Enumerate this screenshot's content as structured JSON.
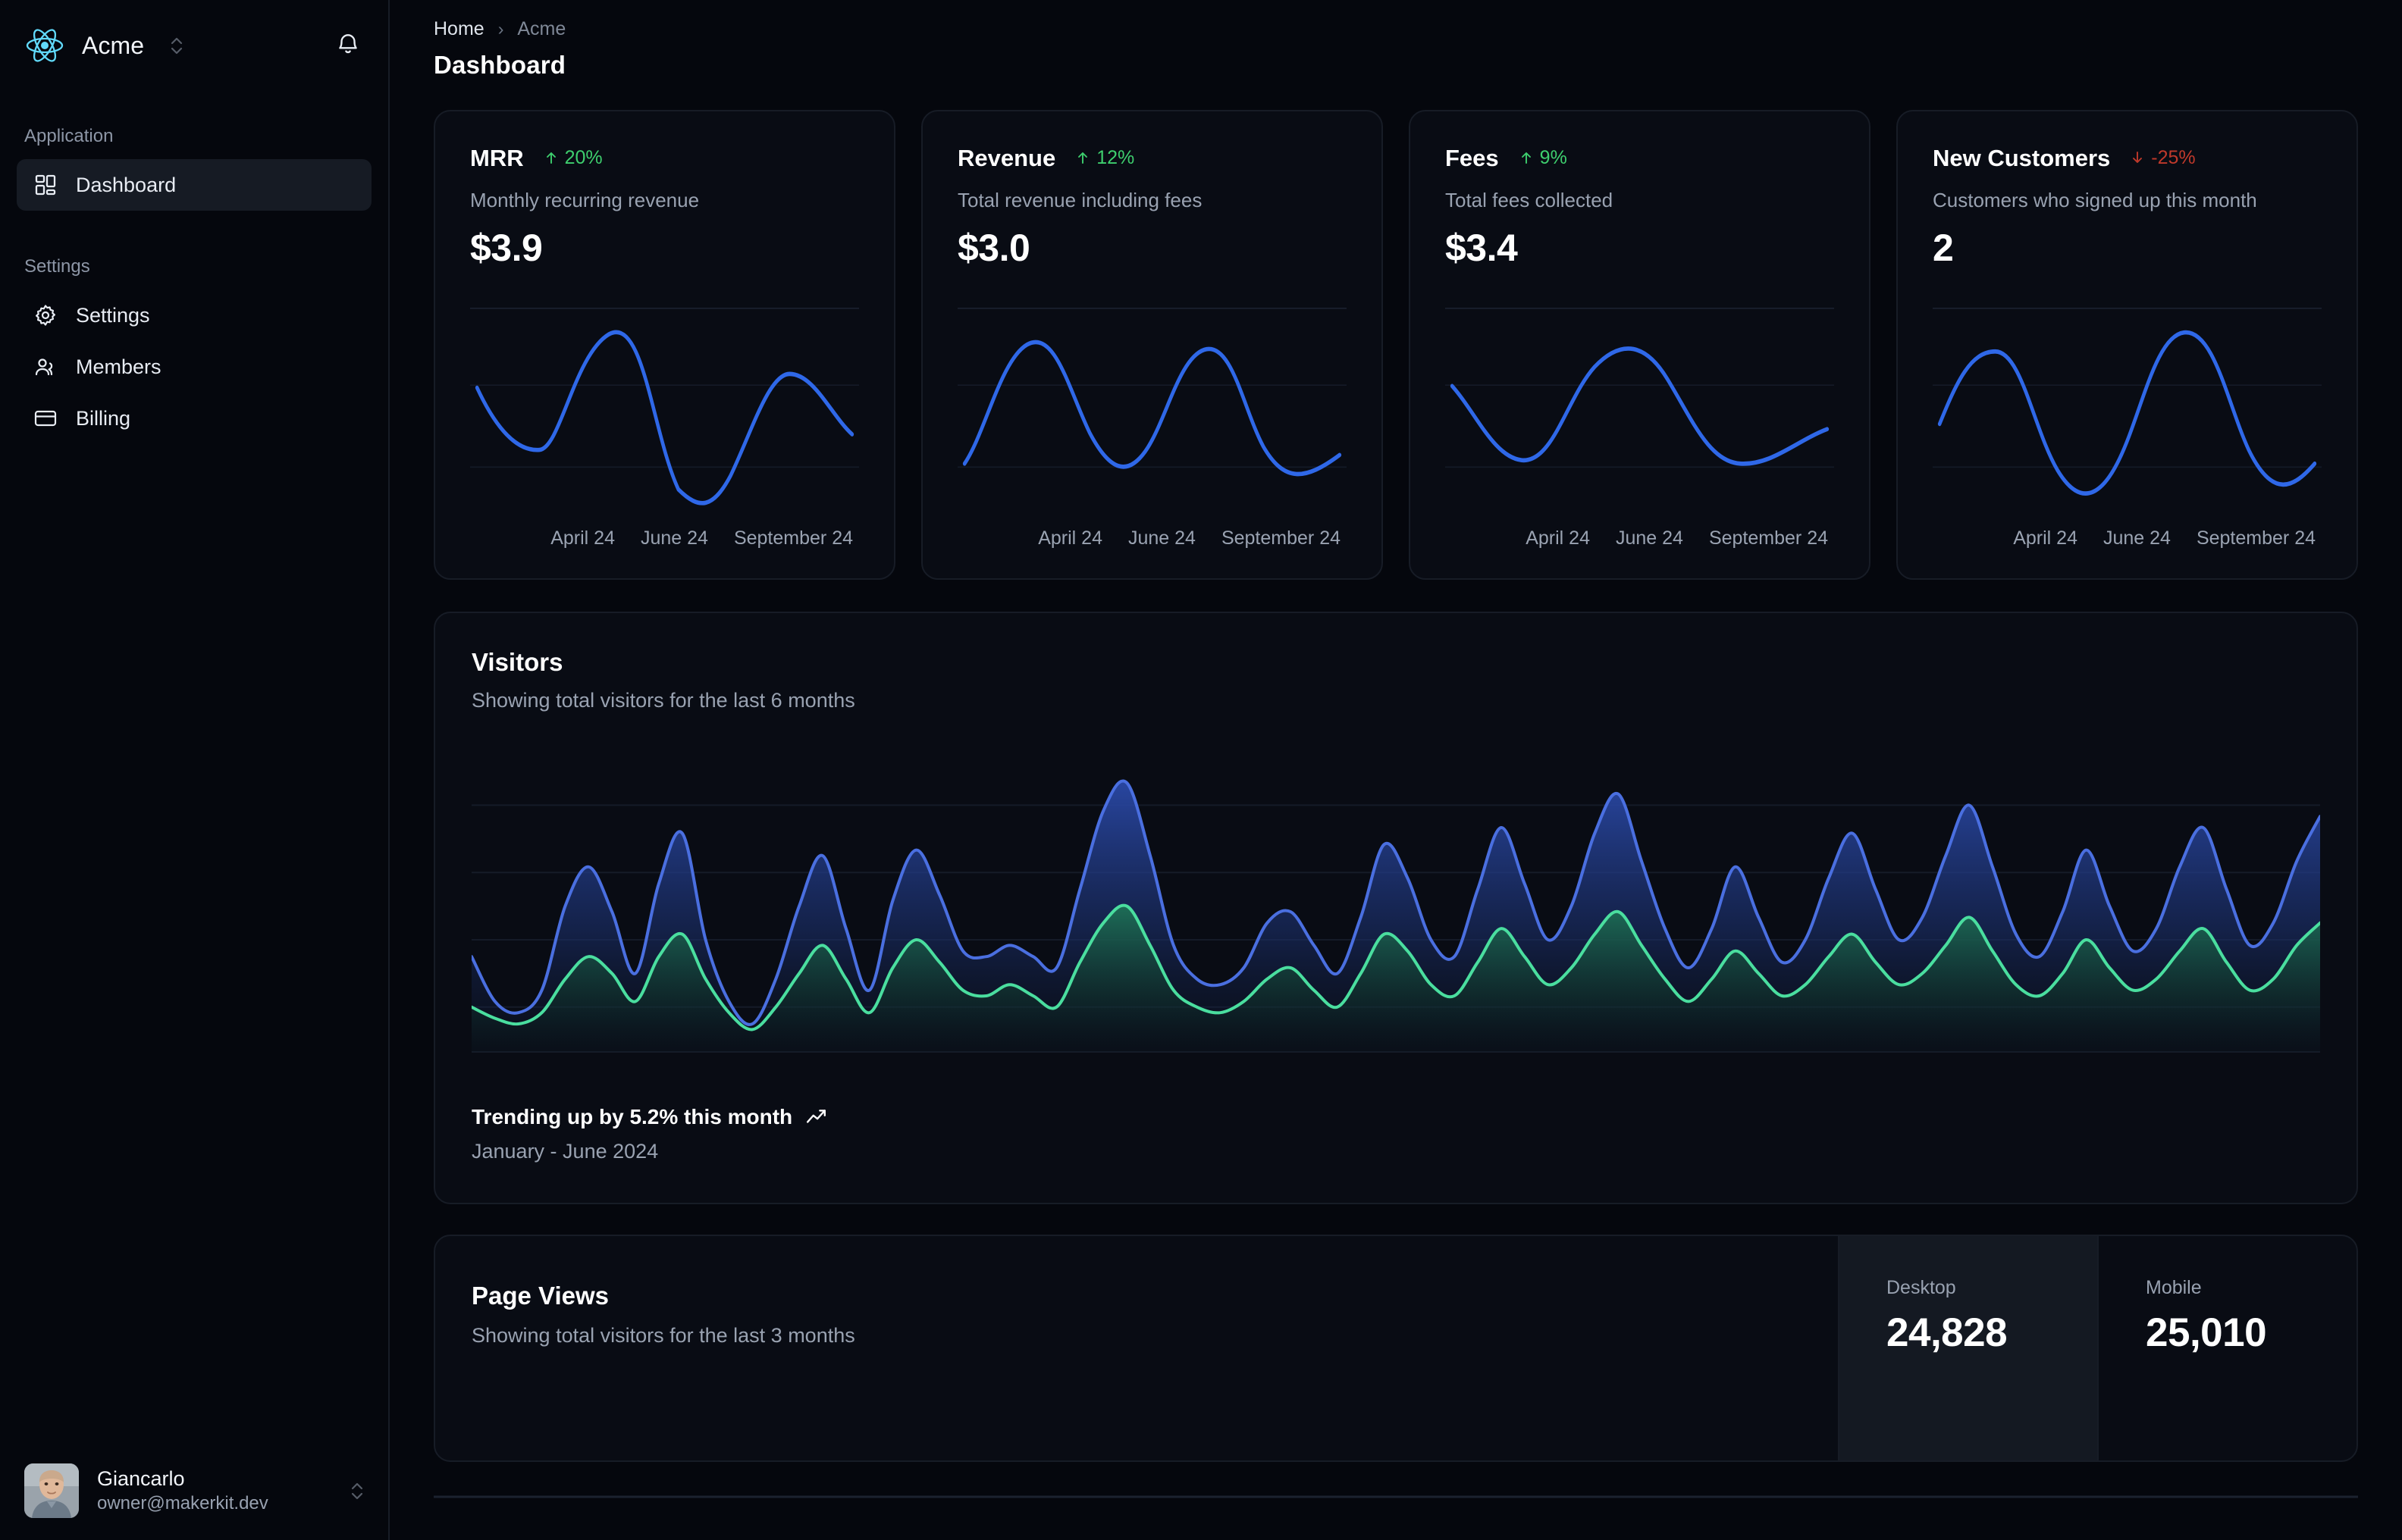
{
  "sidebar": {
    "brand": {
      "name": "Acme",
      "logo_icon": "react-atom-icon",
      "switcher_icon": "chevron-up-down-icon",
      "logo_color": "#61dafb"
    },
    "notifications_icon": "bell-icon",
    "groups": [
      {
        "label": "Application",
        "items": [
          {
            "label": "Dashboard",
            "icon": "layout-dashboard-icon",
            "active": true
          }
        ]
      },
      {
        "label": "Settings",
        "items": [
          {
            "label": "Settings",
            "icon": "gear-icon",
            "active": false
          },
          {
            "label": "Members",
            "icon": "users-icon",
            "active": false
          },
          {
            "label": "Billing",
            "icon": "credit-card-icon",
            "active": false
          }
        ]
      }
    ],
    "user": {
      "name": "Giancarlo",
      "email": "owner@makerkit.dev",
      "avatar_icon": "user-avatar",
      "switcher_icon": "chevron-up-down-icon"
    }
  },
  "header": {
    "breadcrumb": {
      "home": "Home",
      "separator": "›",
      "current": "Acme"
    },
    "title": "Dashboard"
  },
  "stat_cards": [
    {
      "title": "MRR",
      "trend": "20%",
      "trend_dir": "up",
      "trend_icon": "arrow-up-icon",
      "subtitle": "Monthly recurring revenue",
      "value": "$3.9"
    },
    {
      "title": "Revenue",
      "trend": "12%",
      "trend_dir": "up",
      "trend_icon": "arrow-up-icon",
      "subtitle": "Total revenue including fees",
      "value": "$3.0"
    },
    {
      "title": "Fees",
      "trend": "9%",
      "trend_dir": "up",
      "trend_icon": "arrow-up-icon",
      "subtitle": "Total fees collected",
      "value": "$3.4"
    },
    {
      "title": "New Customers",
      "trend": "-25%",
      "trend_dir": "down",
      "trend_icon": "arrow-down-icon",
      "subtitle": "Customers who signed up this month",
      "value": "2"
    }
  ],
  "sparkline_axis": {
    "ticks": [
      "April 24",
      "June 24",
      "September 24"
    ]
  },
  "visitors": {
    "title": "Visitors",
    "subtitle": "Showing total visitors for the last 6 months",
    "footer_main": "Trending up by 5.2% this month",
    "footer_icon": "trending-up-icon",
    "footer_sub": "January - June 2024"
  },
  "page_views": {
    "title": "Page Views",
    "subtitle": "Showing total visitors for the last 3 months",
    "tiles": [
      {
        "label": "Desktop",
        "value": "24,828",
        "active": true
      },
      {
        "label": "Mobile",
        "value": "25,010",
        "active": false
      }
    ]
  },
  "colors": {
    "background": "#05070d",
    "card": "#090c14",
    "border": "#171c26",
    "accent_blue": "#3b6fe8",
    "series_blue": "#4a6fe0",
    "series_green": "#4ade9f",
    "positive": "#3ecf6e",
    "negative": "#c0392b",
    "text_primary": "#ffffff",
    "text_muted": "#99a2b1"
  },
  "chart_data": [
    {
      "type": "line",
      "title": "MRR sparkline",
      "xlabel": "",
      "ylabel": "",
      "tick_labels": [
        "April 24",
        "June 24",
        "September 24"
      ],
      "grid": true,
      "x": [
        0,
        1,
        2,
        3,
        4,
        5,
        6,
        7,
        8,
        9,
        10,
        11,
        12,
        13,
        14,
        15,
        16,
        17,
        18,
        19,
        20,
        21,
        22,
        23,
        24
      ],
      "values": [
        58,
        49,
        38,
        30,
        28,
        33,
        45,
        62,
        78,
        88,
        92,
        88,
        76,
        58,
        38,
        22,
        12,
        8,
        12,
        24,
        42,
        62,
        76,
        82,
        68
      ],
      "ylim": [
        0,
        100
      ]
    },
    {
      "type": "line",
      "title": "Revenue sparkline",
      "tick_labels": [
        "April 24",
        "June 24",
        "September 24"
      ],
      "grid": true,
      "x": [
        0,
        1,
        2,
        3,
        4,
        5,
        6,
        7,
        8,
        9,
        10,
        11,
        12,
        13,
        14,
        15,
        16,
        17,
        18,
        19,
        20,
        21,
        22,
        23,
        24
      ],
      "values": [
        30,
        40,
        56,
        72,
        84,
        88,
        84,
        74,
        60,
        46,
        36,
        32,
        34,
        42,
        54,
        68,
        78,
        82,
        80,
        72,
        60,
        48,
        38,
        32,
        30
      ],
      "ylim": [
        0,
        100
      ]
    },
    {
      "type": "line",
      "title": "Fees sparkline",
      "tick_labels": [
        "April 24",
        "June 24",
        "September 24"
      ],
      "grid": true,
      "x": [
        0,
        1,
        2,
        3,
        4,
        5,
        6,
        7,
        8,
        9,
        10,
        11,
        12,
        13,
        14,
        15,
        16,
        17,
        18,
        19,
        20,
        21,
        22,
        23,
        24
      ],
      "values": [
        62,
        56,
        46,
        34,
        24,
        18,
        16,
        20,
        30,
        44,
        60,
        74,
        84,
        88,
        86,
        78,
        66,
        52,
        40,
        30,
        24,
        22,
        24,
        30,
        36
      ],
      "ylim": [
        0,
        100
      ]
    },
    {
      "type": "line",
      "title": "New Customers sparkline",
      "tick_labels": [
        "April 24",
        "June 24",
        "September 24"
      ],
      "grid": true,
      "x": [
        0,
        1,
        2,
        3,
        4,
        5,
        6,
        7,
        8,
        9,
        10,
        11,
        12,
        13,
        14,
        15,
        16,
        17,
        18,
        19,
        20,
        21,
        22,
        23,
        24
      ],
      "values": [
        34,
        52,
        70,
        80,
        78,
        66,
        50,
        34,
        24,
        26,
        40,
        62,
        82,
        92,
        90,
        78,
        60,
        42,
        28,
        22,
        24,
        32,
        42,
        50,
        54
      ],
      "ylim": [
        0,
        100
      ]
    },
    {
      "type": "area",
      "title": "Visitors",
      "subtitle": "Showing total visitors for the last 6 months",
      "xlabel": "",
      "ylabel": "",
      "grid": true,
      "legend": [],
      "ylim": [
        0,
        100
      ],
      "series": [
        {
          "name": "Desktop",
          "color": "#4a6fe0",
          "values": [
            34,
            18,
            14,
            22,
            52,
            66,
            50,
            28,
            60,
            78,
            40,
            18,
            10,
            26,
            52,
            70,
            44,
            22,
            54,
            72,
            56,
            36,
            34,
            38,
            34,
            30,
            58,
            86,
            96,
            70,
            38,
            26,
            24,
            30,
            46,
            50,
            38,
            28,
            48,
            74,
            62,
            40,
            34,
            58,
            80,
            60,
            40,
            52,
            78,
            92,
            68,
            44,
            30,
            44,
            66,
            48,
            32,
            40,
            62,
            78,
            58,
            40,
            48,
            70,
            88,
            66,
            42,
            34,
            50,
            72,
            52,
            36,
            44,
            66,
            80,
            58,
            38,
            46,
            68,
            84
          ]
        },
        {
          "name": "Mobile",
          "color": "#4ade9f",
          "values": [
            16,
            12,
            10,
            14,
            26,
            34,
            28,
            18,
            34,
            42,
            26,
            14,
            8,
            16,
            28,
            38,
            26,
            14,
            30,
            40,
            32,
            22,
            20,
            24,
            20,
            16,
            32,
            46,
            52,
            38,
            22,
            16,
            14,
            18,
            26,
            30,
            22,
            16,
            28,
            42,
            36,
            24,
            20,
            32,
            44,
            34,
            24,
            30,
            42,
            50,
            38,
            26,
            18,
            26,
            36,
            28,
            20,
            24,
            34,
            42,
            32,
            24,
            28,
            38,
            48,
            36,
            24,
            20,
            28,
            40,
            30,
            22,
            26,
            36,
            44,
            32,
            22,
            26,
            38,
            46
          ]
        }
      ]
    }
  ]
}
